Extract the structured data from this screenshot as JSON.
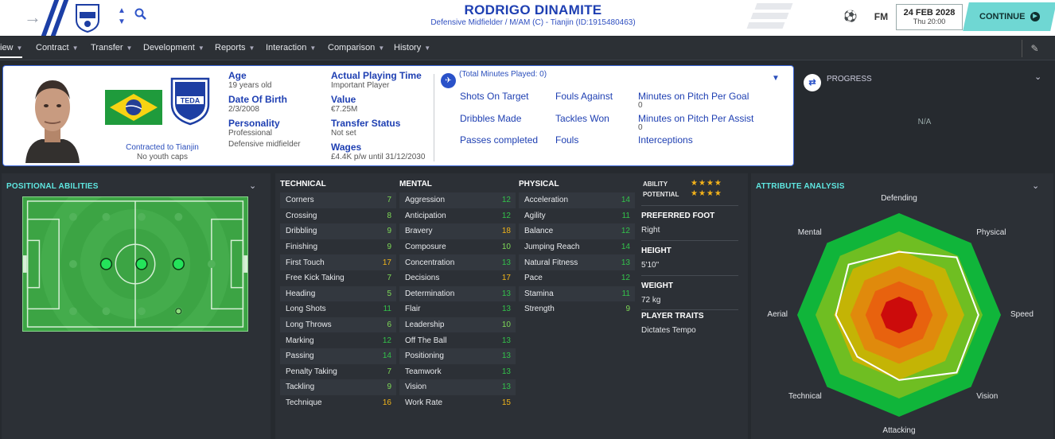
{
  "header": {
    "player_name": "RODRIGO DINAMITE",
    "subtitle": "Defensive Midfielder / M/AM (C) - Tianjin (ID:1915480463)",
    "fm_label": "FM",
    "date": "24 FEB 2028",
    "time": "Thu 20:00",
    "continue_label": "CONTINUE"
  },
  "nav": {
    "items": [
      {
        "label": "iew"
      },
      {
        "label": "Contract"
      },
      {
        "label": "Transfer"
      },
      {
        "label": "Development"
      },
      {
        "label": "Reports"
      },
      {
        "label": "Interaction"
      },
      {
        "label": "Comparison"
      },
      {
        "label": "History"
      }
    ]
  },
  "profile": {
    "club_crest_text": "TEDA",
    "contracted": "Contracted to Tianjin",
    "youth_caps": "No youth caps",
    "age_label": "Age",
    "age": "19 years old",
    "dob_label": "Date Of Birth",
    "dob": "2/3/2008",
    "personality_label": "Personality",
    "personality": "Professional",
    "role": "Defensive midfielder",
    "apt_label": "Actual Playing Time",
    "apt": "Important Player",
    "value_label": "Value",
    "value": "€7.25M",
    "ts_label": "Transfer Status",
    "ts": "Not set",
    "wages_label": "Wages",
    "wages": "£4.4K p/w until 31/12/2030"
  },
  "match_stats": {
    "total_minutes": "(Total Minutes Played: 0)",
    "shots_on_target": "Shots On Target",
    "dribbles_made": "Dribbles Made",
    "passes_completed": "Passes completed",
    "fouls_against": "Fouls Against",
    "tackles_won": "Tackles Won",
    "fouls": "Fouls",
    "min_per_goal": "Minutes on Pitch Per Goal",
    "min_per_goal_v": "0",
    "min_per_assist": "Minutes on Pitch Per Assist",
    "min_per_assist_v": "0",
    "interceptions": "Interceptions"
  },
  "progress": {
    "title": "PROGRESS",
    "value": "N/A"
  },
  "positional": {
    "title": "POSITIONAL ABILITIES"
  },
  "attributes": {
    "technical_title": "TECHNICAL",
    "mental_title": "MENTAL",
    "physical_title": "PHYSICAL",
    "technical": [
      {
        "name": "Corners",
        "value": "7"
      },
      {
        "name": "Crossing",
        "value": "8"
      },
      {
        "name": "Dribbling",
        "value": "9"
      },
      {
        "name": "Finishing",
        "value": "9"
      },
      {
        "name": "First Touch",
        "value": "17"
      },
      {
        "name": "Free Kick Taking",
        "value": "7"
      },
      {
        "name": "Heading",
        "value": "5"
      },
      {
        "name": "Long Shots",
        "value": "11"
      },
      {
        "name": "Long Throws",
        "value": "6"
      },
      {
        "name": "Marking",
        "value": "12"
      },
      {
        "name": "Passing",
        "value": "14"
      },
      {
        "name": "Penalty Taking",
        "value": "7"
      },
      {
        "name": "Tackling",
        "value": "9"
      },
      {
        "name": "Technique",
        "value": "16"
      }
    ],
    "mental": [
      {
        "name": "Aggression",
        "value": "12"
      },
      {
        "name": "Anticipation",
        "value": "12"
      },
      {
        "name": "Bravery",
        "value": "18"
      },
      {
        "name": "Composure",
        "value": "10"
      },
      {
        "name": "Concentration",
        "value": "13"
      },
      {
        "name": "Decisions",
        "value": "17"
      },
      {
        "name": "Determination",
        "value": "13"
      },
      {
        "name": "Flair",
        "value": "13"
      },
      {
        "name": "Leadership",
        "value": "10"
      },
      {
        "name": "Off The Ball",
        "value": "13"
      },
      {
        "name": "Positioning",
        "value": "13"
      },
      {
        "name": "Teamwork",
        "value": "13"
      },
      {
        "name": "Vision",
        "value": "13"
      },
      {
        "name": "Work Rate",
        "value": "15"
      }
    ],
    "physical": [
      {
        "name": "Acceleration",
        "value": "14"
      },
      {
        "name": "Agility",
        "value": "11"
      },
      {
        "name": "Balance",
        "value": "12"
      },
      {
        "name": "Jumping Reach",
        "value": "14"
      },
      {
        "name": "Natural Fitness",
        "value": "13"
      },
      {
        "name": "Pace",
        "value": "12"
      },
      {
        "name": "Stamina",
        "value": "11"
      },
      {
        "name": "Strength",
        "value": "9"
      }
    ]
  },
  "info": {
    "ability_label": "ABILITY",
    "ability_stars": 4,
    "potential_label": "POTENTIAL",
    "potential_stars": 4,
    "pref_foot_label": "PREFERRED FOOT",
    "pref_foot": "Right",
    "height_label": "HEIGHT",
    "height": "5'10\"",
    "weight_label": "WEIGHT",
    "weight": "72 kg",
    "traits_label": "PLAYER TRAITS",
    "traits": "Dictates Tempo"
  },
  "analysis": {
    "title": "ATTRIBUTE ANALYSIS",
    "labels": [
      "Defending",
      "Physical",
      "Speed",
      "Vision",
      "Attacking",
      "Technical",
      "Aerial",
      "Mental"
    ],
    "values": [
      0.62,
      0.8,
      0.78,
      0.8,
      0.64,
      0.58,
      0.62,
      0.7
    ],
    "colors": [
      "#10b53a",
      "#6fbe22",
      "#c4b405",
      "#e08a0c",
      "#e8620e",
      "#cc0b0b"
    ]
  }
}
